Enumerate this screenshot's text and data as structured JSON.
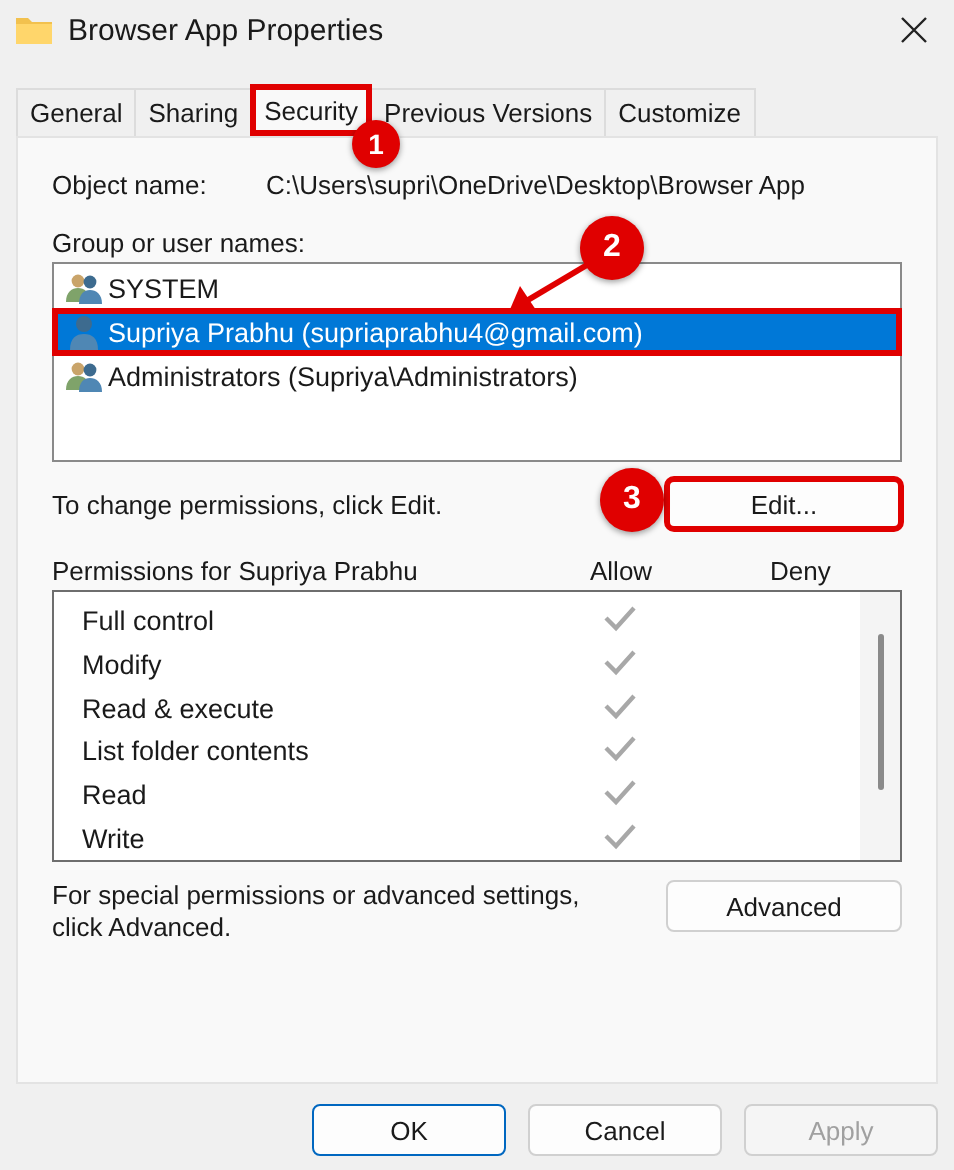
{
  "window": {
    "title": "Browser App Properties"
  },
  "tabs": [
    {
      "label": "General",
      "selected": false,
      "highlighted": false
    },
    {
      "label": "Sharing",
      "selected": false,
      "highlighted": false
    },
    {
      "label": "Security",
      "selected": true,
      "highlighted": true,
      "step": "1"
    },
    {
      "label": "Previous Versions",
      "selected": false,
      "highlighted": false
    },
    {
      "label": "Customize",
      "selected": false,
      "highlighted": false
    }
  ],
  "object_name": {
    "label": "Object name:",
    "value": "C:\\Users\\supri\\OneDrive\\Desktop\\Browser App"
  },
  "group_list": {
    "label": "Group or user names:",
    "items": [
      {
        "name": "SYSTEM",
        "kind": "group",
        "selected": false,
        "highlighted": false
      },
      {
        "name": "Supriya Prabhu (supriaprabhu4@gmail.com)",
        "kind": "user",
        "selected": true,
        "highlighted": true,
        "step": "2"
      },
      {
        "name": "Administrators (Supriya\\Administrators)",
        "kind": "group",
        "selected": false,
        "highlighted": false
      }
    ]
  },
  "change_hint": "To change permissions, click Edit.",
  "edit_button": {
    "label": "Edit...",
    "highlighted": true,
    "step": "3"
  },
  "permissions": {
    "title": "Permissions for Supriya Prabhu",
    "allow_header": "Allow",
    "deny_header": "Deny",
    "rows": [
      {
        "label": "Full control",
        "allow": true,
        "deny": false
      },
      {
        "label": "Modify",
        "allow": true,
        "deny": false
      },
      {
        "label": "Read & execute",
        "allow": true,
        "deny": false
      },
      {
        "label": "List folder contents",
        "allow": true,
        "deny": false
      },
      {
        "label": "Read",
        "allow": true,
        "deny": false
      },
      {
        "label": "Write",
        "allow": true,
        "deny": false
      }
    ]
  },
  "advanced_hint": "For special permissions or advanced settings, click Advanced.",
  "advanced_button": {
    "label": "Advanced"
  },
  "buttons": [
    {
      "label": "OK",
      "default": true,
      "disabled": false
    },
    {
      "label": "Cancel",
      "default": false,
      "disabled": false
    },
    {
      "label": "Apply",
      "default": false,
      "disabled": true
    }
  ]
}
